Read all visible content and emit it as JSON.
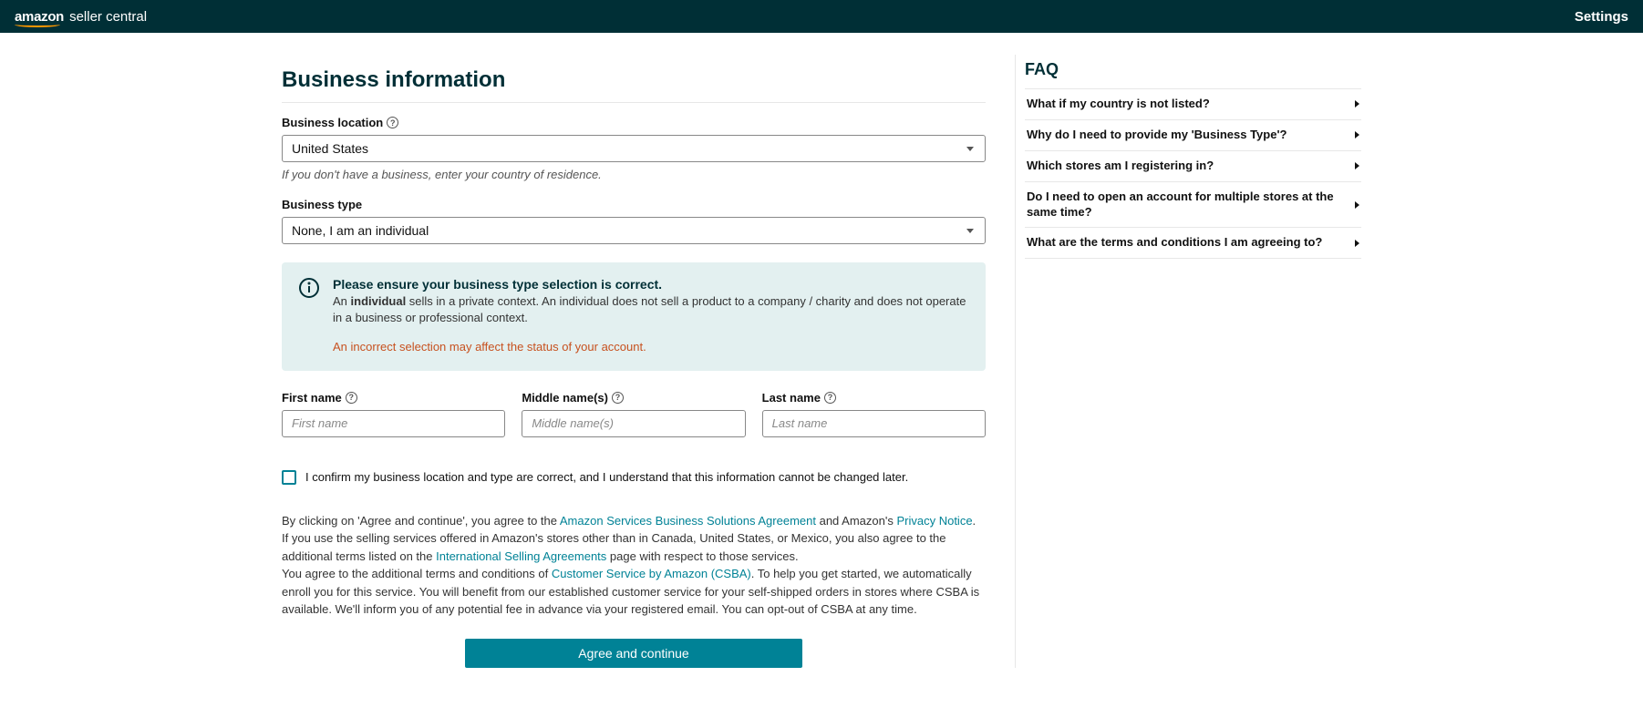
{
  "header": {
    "brand_amazon": "amazon",
    "brand_sc": "seller central",
    "settings_label": "Settings"
  },
  "page_title": "Business information",
  "business_location": {
    "label": "Business location",
    "value": "United States",
    "helper": "If you don't have a business, enter your country of residence."
  },
  "business_type": {
    "label": "Business type",
    "value": "None, I am an individual"
  },
  "info_box": {
    "title": "Please ensure your business type selection is correct.",
    "line_prefix": "An ",
    "line_bold": "individual",
    "line_rest": " sells in a private context. An individual does not sell a product to a company / charity and does not operate in a business or professional context.",
    "warning": "An incorrect selection may affect the status of your account."
  },
  "name_fields": {
    "first": {
      "label": "First name",
      "placeholder": "First name"
    },
    "middle": {
      "label": "Middle name(s)",
      "placeholder": "Middle name(s)"
    },
    "last": {
      "label": "Last name",
      "placeholder": "Last name"
    }
  },
  "confirm_label": "I confirm my business location and type are correct, and I understand that this information cannot be changed later.",
  "legal": {
    "p1_a": "By clicking on 'Agree and continue', you agree to the ",
    "p1_link1": "Amazon Services Business Solutions Agreement",
    "p1_b": " and Amazon's ",
    "p1_link2": "Privacy Notice",
    "p1_c": ".",
    "p2_a": "If you use the selling services offered in Amazon's stores other than in Canada, United States, or Mexico, you also agree to the additional terms listed on the ",
    "p2_link": "International Selling Agreements",
    "p2_b": " page with respect to those services.",
    "p3_a": "You agree to the additional terms and conditions of ",
    "p3_link": "Customer Service by Amazon (CSBA)",
    "p3_b": ". To help you get started, we automatically enroll you for this service. You will benefit from our established customer service for your self-shipped orders in stores where CSBA is available. We'll inform you of any potential fee in advance via your registered email. You can opt-out of CSBA at any time."
  },
  "cta_label": "Agree and continue",
  "faq": {
    "title": "FAQ",
    "items": [
      "What if my country is not listed?",
      "Why do I need to provide my 'Business Type'?",
      "Which stores am I registering in?",
      "Do I need to open an account for multiple stores at the same time?",
      "What are the terms and conditions I am agreeing to?"
    ]
  }
}
